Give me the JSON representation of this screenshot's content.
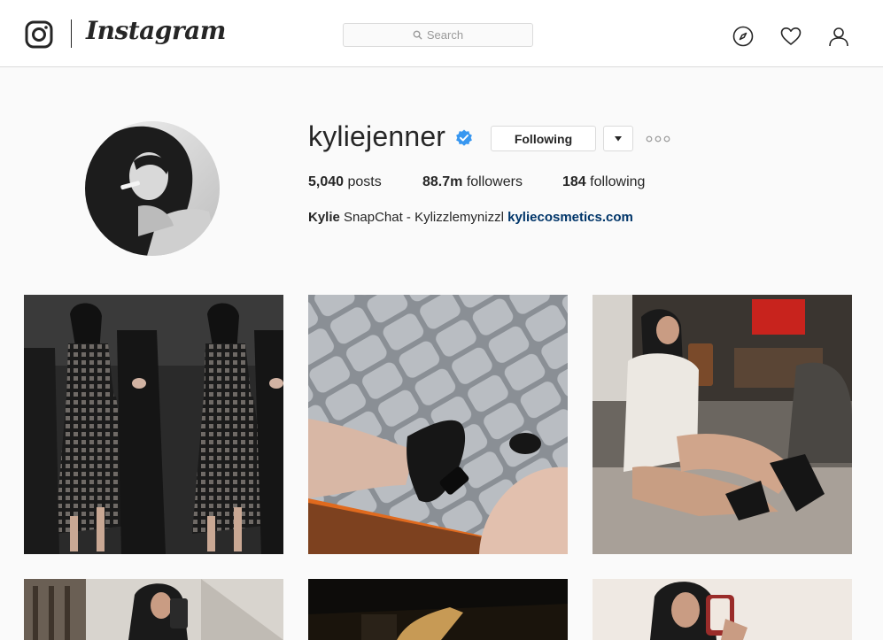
{
  "nav": {
    "brand": "Instagram",
    "search_placeholder": "Search",
    "icons": [
      "instagram-camera-icon",
      "compass-icon",
      "heart-icon",
      "profile-icon"
    ]
  },
  "profile": {
    "username": "kyliejenner",
    "verified": true,
    "follow_button": "Following",
    "stats": {
      "posts_count": "5,040",
      "posts_label": "posts",
      "followers_count": "88.7m",
      "followers_label": "followers",
      "following_count": "184",
      "following_label": "following"
    },
    "bio": {
      "name": "Kylie",
      "text": "SnapChat - Kylizzlemynizzl",
      "link": "kyliecosmetics.com"
    }
  },
  "colors": {
    "background": "#fafafa",
    "border": "#dbdbdb",
    "verified_blue": "#3897f0",
    "link": "#003569"
  },
  "grid": {
    "posts": [
      {
        "type": "photo"
      },
      {
        "type": "photo"
      },
      {
        "type": "photo"
      },
      {
        "type": "photo"
      },
      {
        "type": "video",
        "badge_icon": "video-camera-icon"
      },
      {
        "type": "photo"
      }
    ]
  }
}
